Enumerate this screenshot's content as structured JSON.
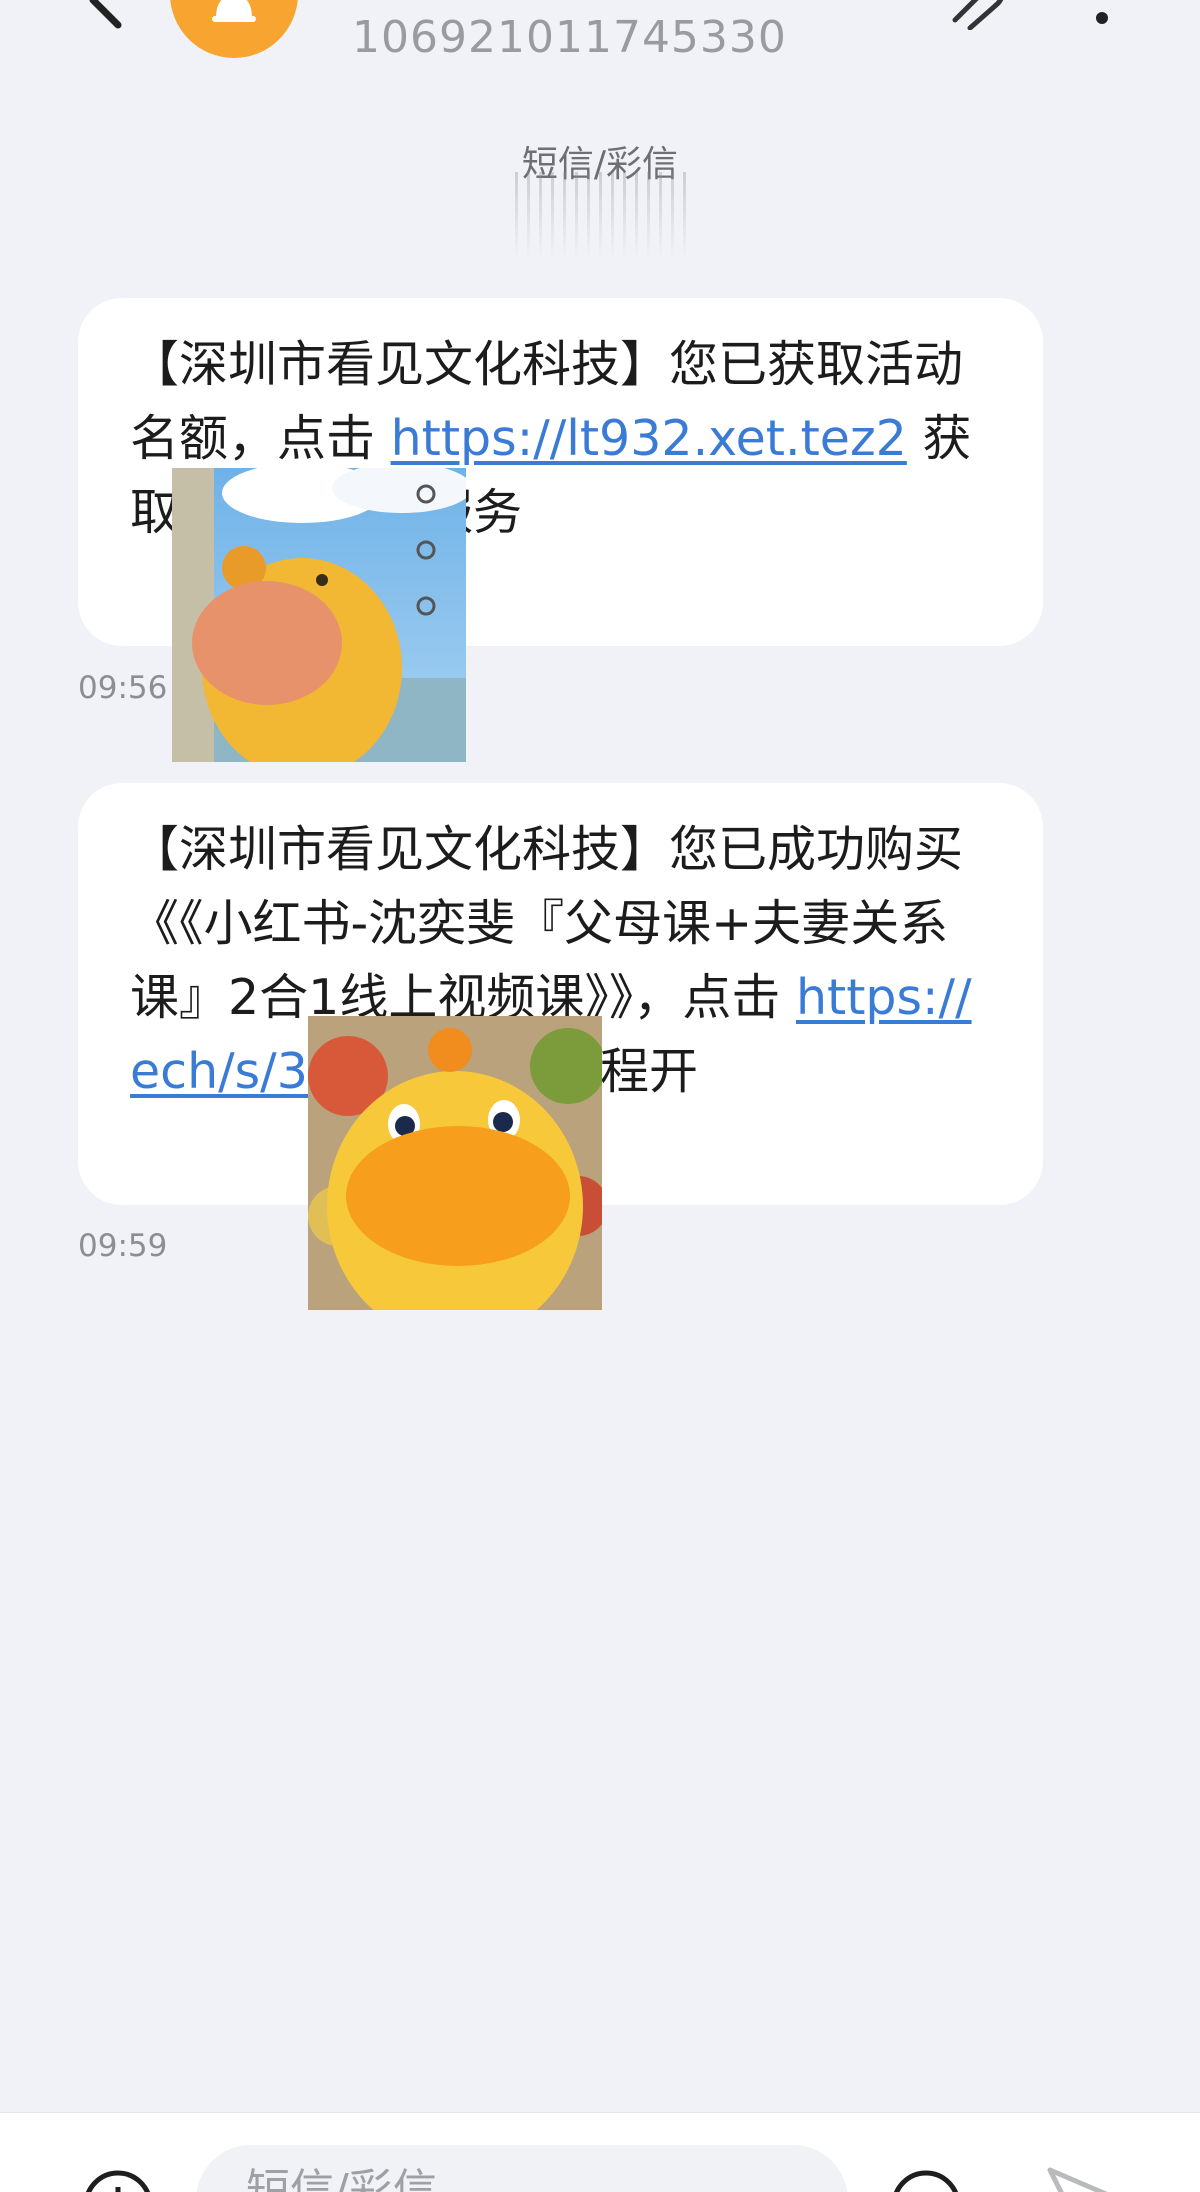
{
  "header": {
    "sender_number": "106921011745330"
  },
  "conversation": {
    "message_type_label": "短信/彩信",
    "messages": [
      {
        "text_before": "【深圳市看见文化科技】您已获取活动名额，点击 ",
        "link": "https://lt932.xet.te",
        "link_tail": "z2",
        "text_after": " 获取更多信息及服务",
        "time": "09:56"
      },
      {
        "text_before": "【深圳市看见文化科技】您已成功购买《《小红书-沈奕斐『父母课+夫妻关系课』2合1线上视频课》》，点击 ",
        "link": "https://",
        "link_tail": "ech/s/3Mllhx",
        "text_after": " 兑换课程开",
        "time": "09:59"
      }
    ]
  },
  "composer": {
    "placeholder": "短信/彩信"
  },
  "colors": {
    "background": "#f1f2f7",
    "bubble": "#ffffff",
    "link": "#3a7bd5",
    "avatar": "#f7a530"
  }
}
